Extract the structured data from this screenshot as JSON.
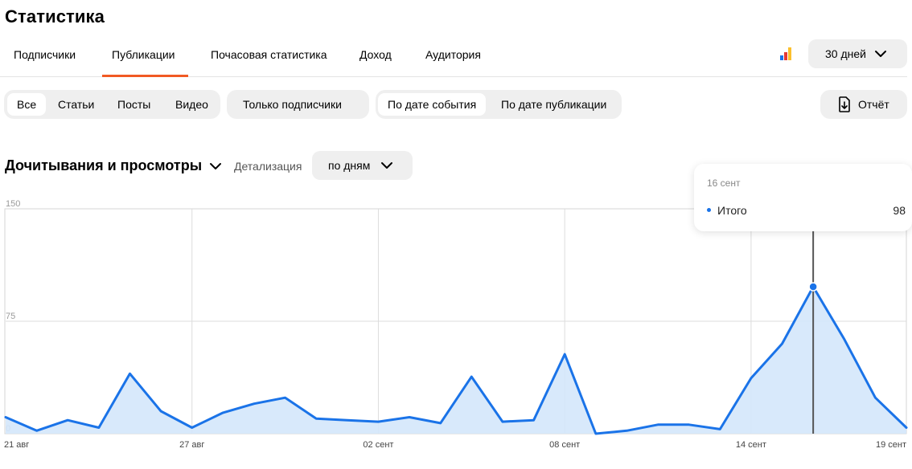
{
  "page": {
    "title": "Статистика"
  },
  "tabs": [
    {
      "label": "Подписчики"
    },
    {
      "label": "Публикации",
      "active": true
    },
    {
      "label": "Почасовая статистика"
    },
    {
      "label": "Доход"
    },
    {
      "label": "Аудитория"
    }
  ],
  "period": {
    "label": "30 дней"
  },
  "content_filter": [
    {
      "label": "Все",
      "active": true
    },
    {
      "label": "Статьи"
    },
    {
      "label": "Посты"
    },
    {
      "label": "Видео"
    }
  ],
  "subscribers_filter": {
    "label": "Только подписчики"
  },
  "date_mode": [
    {
      "label": "По дате события",
      "active": true
    },
    {
      "label": "По дате публикации"
    }
  ],
  "report": {
    "label": "Отчёт"
  },
  "metric": {
    "label": "Дочитывания и просмотры"
  },
  "detail": {
    "label": "Детализация",
    "value": "по дням"
  },
  "icons": {
    "stats": "bar-chart-icon",
    "report": "document-export-icon",
    "dropdown": "chevron-down-icon"
  },
  "colors": {
    "accent": "#f15a24",
    "line": "#1a73e8",
    "area": "#d4e7fb",
    "icon_bars": [
      "#1a73e8",
      "#e53935",
      "#fbc02d"
    ]
  },
  "tooltip": {
    "date": "16 сент",
    "series": "Итого",
    "value": "98"
  },
  "chart_data": {
    "type": "area",
    "x": [
      "21 авг",
      "22 авг",
      "23 авг",
      "24 авг",
      "25 авг",
      "26 авг",
      "27 авг",
      "28 авг",
      "29 авг",
      "30 авг",
      "31 авг",
      "01 сент",
      "02 сент",
      "03 сент",
      "04 сент",
      "05 сент",
      "06 сент",
      "07 сент",
      "08 сент",
      "09 сент",
      "10 сент",
      "11 сент",
      "12 сент",
      "13 сент",
      "14 сент",
      "15 сент",
      "16 сент",
      "17 сент",
      "18 сент",
      "19 сент"
    ],
    "series": [
      {
        "values": [
          11,
          2,
          9,
          4,
          40,
          15,
          4,
          14,
          20,
          24,
          10,
          9,
          8,
          11,
          7,
          38,
          8,
          9,
          53,
          0,
          2,
          6,
          6,
          3,
          37,
          60,
          98,
          63,
          24,
          4
        ]
      }
    ],
    "xticks": [
      "21 авг",
      "27 авг",
      "02 сент",
      "08 сент",
      "14 сент",
      "19 сент"
    ],
    "yticks": [
      "0",
      "75",
      "150"
    ],
    "ylim": [
      0,
      150
    ],
    "highlight_x": "16 сент",
    "grid": true
  }
}
